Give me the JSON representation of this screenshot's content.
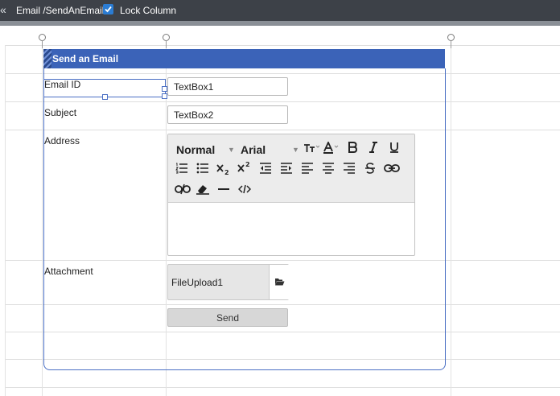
{
  "topbar": {
    "breadcrumb": "Email /SendAnEmail",
    "lock_label": "Lock Column",
    "lock_checked": true
  },
  "panel": {
    "title": "Send an Email"
  },
  "form": {
    "labels": {
      "email": "Email ID",
      "subject": "Subject",
      "address": "Address",
      "attachment": "Attachment"
    },
    "email_box": "TextBox1",
    "subject_box": "TextBox2",
    "editor": {
      "format": "Normal",
      "font": "Arial"
    },
    "upload_label": "FileUpload1",
    "send_label": "Send"
  },
  "colors": {
    "header": "#3b63b8",
    "topbar": "#3d4148",
    "accent": "#2b7cd3"
  }
}
